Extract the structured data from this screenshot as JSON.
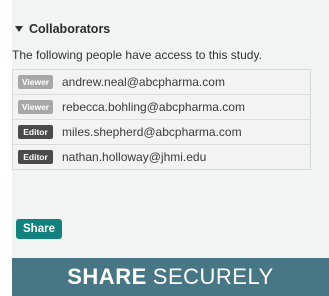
{
  "section": {
    "title": "Collaborators",
    "description": "The following people have access to this study."
  },
  "collaborators": [
    {
      "role": "Viewer",
      "email": "andrew.neal@abcpharma.com"
    },
    {
      "role": "Viewer",
      "email": "rebecca.bohling@abcpharma.com"
    },
    {
      "role": "Editor",
      "email": "miles.shepherd@abcpharma.com"
    },
    {
      "role": "Editor",
      "email": "nathan.holloway@jhmi.edu"
    }
  ],
  "colors": {
    "viewer_badge": "#a8a8a8",
    "editor_badge": "#4a4a4a",
    "share_button": "#11827e",
    "banner": "#477685"
  },
  "share_button": {
    "label": "Share"
  },
  "banner": {
    "bold": "SHARE",
    "normal": "SECURELY"
  }
}
